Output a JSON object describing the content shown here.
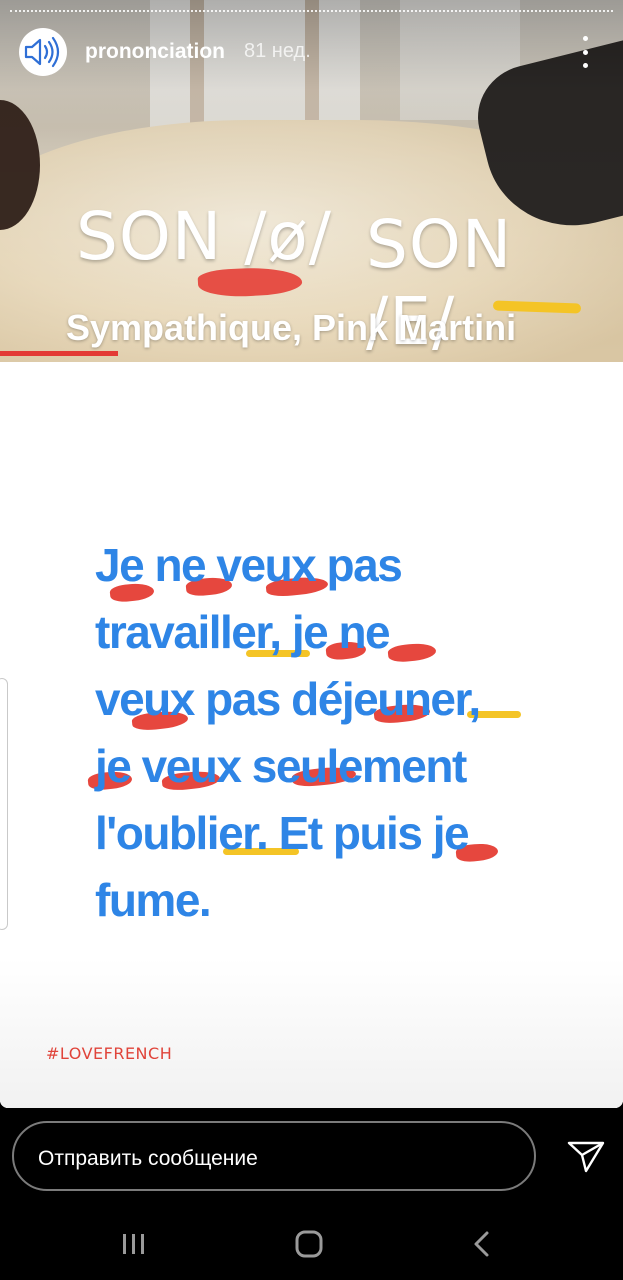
{
  "story": {
    "username": "prononciation",
    "time_ago": "81 нед.",
    "progress": 0.0
  },
  "poster": {
    "title_left": "SON /ø/",
    "title_right": "SON /E/",
    "song": "Sympathique, Pink Martini",
    "lyrics": "Je ne veux pas\ntravailler, je ne\nveux pas déjeuner,\nje veux seulement\nl'oublier. Et puis je\nfume.",
    "hashtag": "#LOVEFRENCH"
  },
  "composer": {
    "placeholder": "Отправить сообщение"
  },
  "colors": {
    "lyrics": "#2e85e6",
    "highlight_red": "#e6473e",
    "highlight_yellow": "#f4c426",
    "background": "#000000"
  },
  "icons": {
    "avatar": "speaker-icon",
    "more": "more-vertical-icon",
    "send": "send-icon",
    "nav_recent": "recent-apps-icon",
    "nav_home": "home-icon",
    "nav_back": "back-icon"
  }
}
